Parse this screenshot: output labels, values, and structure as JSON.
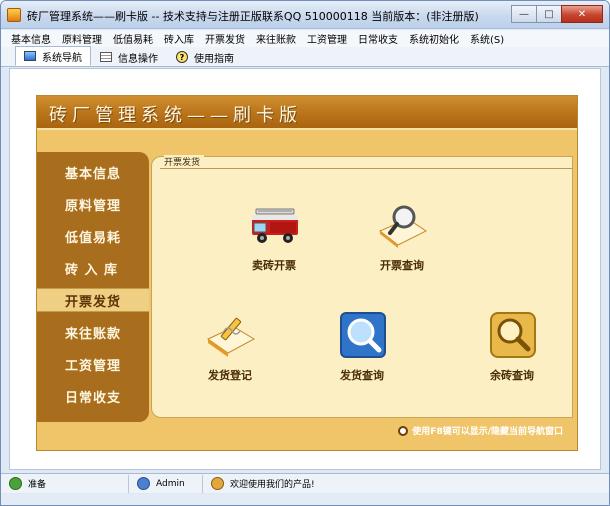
{
  "window": {
    "title": "砖厂管理系统——刷卡版 -- 技术支持与注册正版联系QQ 510000118    当前版本：(非注册版)",
    "minimize_glyph": "—",
    "maximize_glyph": "□",
    "close_glyph": "✕"
  },
  "menu": {
    "items": [
      "基本信息",
      "原料管理",
      "低值易耗",
      "砖入库",
      "开票发货",
      "来往账款",
      "工资管理",
      "日常收支",
      "系统初始化",
      "系统(S)"
    ]
  },
  "tabs": [
    {
      "label": "系统导航",
      "icon": "monitor-icon",
      "active": true
    },
    {
      "label": "信息操作",
      "icon": "grid-icon",
      "active": false
    },
    {
      "label": "使用指南",
      "icon": "help-icon",
      "active": false
    }
  ],
  "banner": {
    "title": "砖厂管理系统——刷卡版"
  },
  "nav": {
    "items": [
      "基本信息",
      "原料管理",
      "低值易耗",
      "砖 入 库",
      "开票发货",
      "来往账款",
      "工资管理",
      "日常收支"
    ],
    "active_index": 4
  },
  "section": {
    "title": "开票发货"
  },
  "actions": [
    {
      "label": "卖砖开票",
      "icon": "fire-truck-icon"
    },
    {
      "label": "开票查询",
      "icon": "magnifier-document-icon"
    },
    {
      "label": "发货登记",
      "icon": "pencil-document-icon"
    },
    {
      "label": "发货查询",
      "icon": "blue-magnifier-icon"
    },
    {
      "label": "余砖查询",
      "icon": "gold-magnifier-icon"
    }
  ],
  "hint": {
    "text": "使用F8键可以显示/隐藏当前导航窗口"
  },
  "status": {
    "state": "准备",
    "user": "Admin",
    "welcome": "欢迎使用我们的产品!"
  },
  "colors": {
    "banner_brown": "#b87118",
    "sidebar_brown": "#a86d1d",
    "panel_gold": "#f0c56a",
    "inner_cream": "#fcefc3"
  }
}
